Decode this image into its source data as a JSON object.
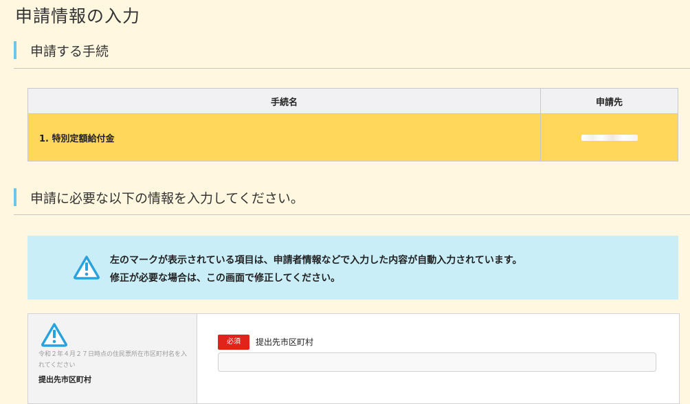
{
  "page": {
    "title": "申請情報の入力"
  },
  "section_procedure": {
    "heading": "申請する手続"
  },
  "procedure_table": {
    "headers": [
      "手続名",
      "申請先"
    ],
    "rows": [
      {
        "name": "1. 特別定額給付金",
        "destination": ""
      }
    ]
  },
  "section_input": {
    "heading": "申請に必要な以下の情報を入力してください。"
  },
  "notice": {
    "line1": "左のマークが表示されている項目は、申請者情報などで入力した内容が自動入力されています。",
    "line2": "修正が必要な場合は、この画面で修正してください。",
    "icon": "warning-triangle-icon"
  },
  "form": {
    "field": {
      "help_text": "令和２年４月２７日時点の住民票所在市区町村名を入れてください",
      "side_label": "提出先市区町村",
      "required_badge": "必須",
      "label": "提出先市区町村",
      "value": ""
    }
  },
  "colors": {
    "background": "#fff7e0",
    "accent_bar": "#6bc6e8",
    "highlight_row": "#ffd75a",
    "notice_bg": "#c9eef8",
    "required_badge": "#e0241c",
    "warning_icon": "#29a3dd"
  }
}
